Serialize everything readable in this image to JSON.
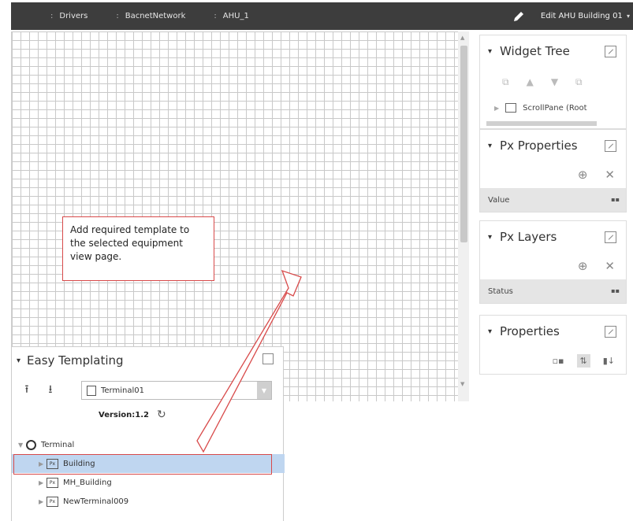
{
  "breadcrumbs": [
    {
      "sep": ":",
      "label": "Drivers"
    },
    {
      "sep": ":",
      "label": "BacnetNetwork"
    },
    {
      "sep": ":",
      "label": "AHU_1"
    }
  ],
  "edit_label": "Edit AHU Building 01",
  "callout_text": "Add required template to the selected equipment view page.",
  "widget_tree": {
    "title": "Widget Tree",
    "node_label": "ScrollPane (Root"
  },
  "px_properties": {
    "title": "Px Properties",
    "row_label": "Value"
  },
  "px_layers": {
    "title": "Px Layers",
    "row_label": "Status"
  },
  "properties": {
    "title": "Properties"
  },
  "easy_templating": {
    "title": "Easy Templating",
    "selected_template": "Terminal01",
    "version_text": "Version:1.2",
    "tree": {
      "root": "Terminal",
      "items": [
        "Building",
        "MH_Building",
        "NewTerminal009"
      ],
      "selected": "Building"
    }
  },
  "colors": {
    "topbar": "#3d3d3d",
    "callout_border": "#d84a4a",
    "selected_row": "#bfd6f0"
  }
}
